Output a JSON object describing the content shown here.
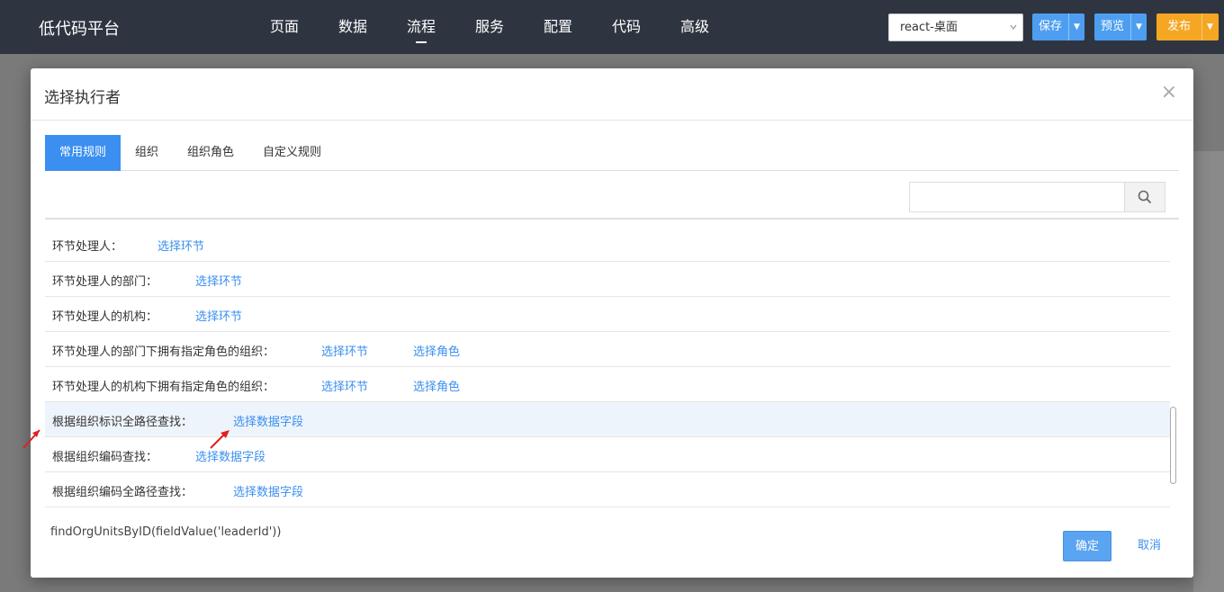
{
  "app": {
    "title": "低代码平台"
  },
  "nav": [
    {
      "label": "页面"
    },
    {
      "label": "数据"
    },
    {
      "label": "流程",
      "active": true
    },
    {
      "label": "服务"
    },
    {
      "label": "配置"
    },
    {
      "label": "代码"
    },
    {
      "label": "高级"
    }
  ],
  "env_select": {
    "value": "react-桌面"
  },
  "toolbar": {
    "save_label": "保存",
    "preview_label": "预览",
    "publish_label": "发布"
  },
  "colors": {
    "topbar": "#2e3541",
    "accent": "#3b8ff0",
    "publish": "#f5a623"
  },
  "modal": {
    "title": "选择执行者",
    "close_icon": "close-icon",
    "tabs": [
      {
        "label": "常用规则",
        "active": true
      },
      {
        "label": "组织"
      },
      {
        "label": "组织角色"
      },
      {
        "label": "自定义规则"
      }
    ],
    "search": {
      "value": "",
      "placeholder": ""
    },
    "rows": [
      {
        "label": "环节处理人：",
        "links": [
          "选择环节"
        ]
      },
      {
        "label": "环节处理人的部门：",
        "links": [
          "选择环节"
        ]
      },
      {
        "label": "环节处理人的机构：",
        "links": [
          "选择环节"
        ]
      },
      {
        "label": "环节处理人的部门下拥有指定角色的组织：",
        "links": [
          "选择环节",
          "选择角色"
        ]
      },
      {
        "label": "环节处理人的机构下拥有指定角色的组织：",
        "links": [
          "选择环节",
          "选择角色"
        ]
      },
      {
        "label": "根据组织标识全路径查找：",
        "links": [
          "选择数据字段"
        ],
        "highlighted": true
      },
      {
        "label": "根据组织编码查找：",
        "links": [
          "选择数据字段"
        ]
      },
      {
        "label": "根据组织编码全路径查找：",
        "links": [
          "选择数据字段"
        ]
      }
    ],
    "expression": "findOrgUnitsByID(fieldValue('leaderId'))",
    "ok_label": "确定",
    "cancel_label": "取消"
  }
}
